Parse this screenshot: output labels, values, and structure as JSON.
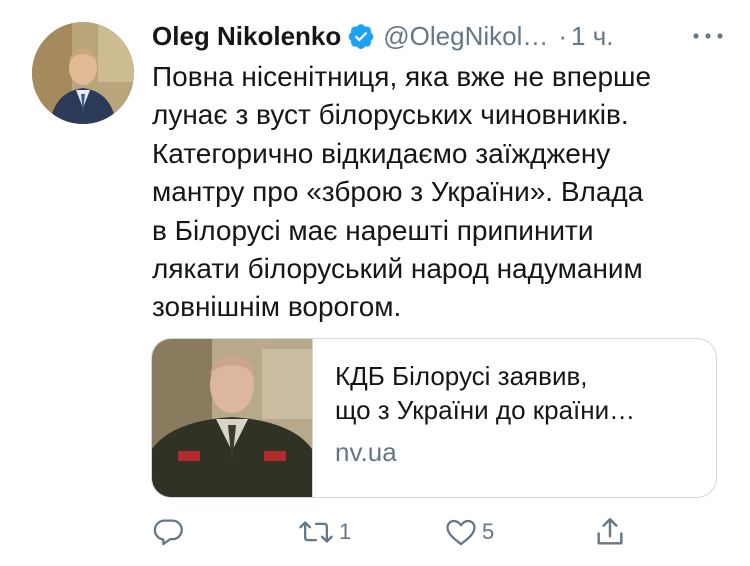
{
  "tweet": {
    "author_name": "Oleg Nikolenko",
    "handle": "@OlegNikol…",
    "separator": "·",
    "time": "1 ч.",
    "verified": true,
    "text_lines": [
      "Повна нісенітниця, яка вже не вперше",
      "лунає з вуст білоруських чиновників.",
      "Категорично відкидаємо заїжджену",
      "мантру про «зброю з України». Влада",
      "в Білорусі має нарешті припинити",
      "лякати білоруський народ надуманим",
      "зовнішнім ворогом."
    ],
    "card": {
      "title_lines": [
        "КДБ Білорусі заявив,",
        "що з України до країни…"
      ],
      "domain": "nv.ua"
    },
    "actions": {
      "reply_count": "",
      "retweet_count": "1",
      "like_count": "5"
    }
  },
  "icons": {
    "verified": "verified-badge-icon",
    "more": "more-dots-icon",
    "reply": "reply-bubble-icon",
    "retweet": "retweet-icon",
    "like": "heart-icon",
    "share": "share-icon"
  },
  "colors": {
    "text": "#14171a",
    "secondary": "#657786",
    "verified_blue": "#1da1f2",
    "border": "#cfd9de"
  }
}
